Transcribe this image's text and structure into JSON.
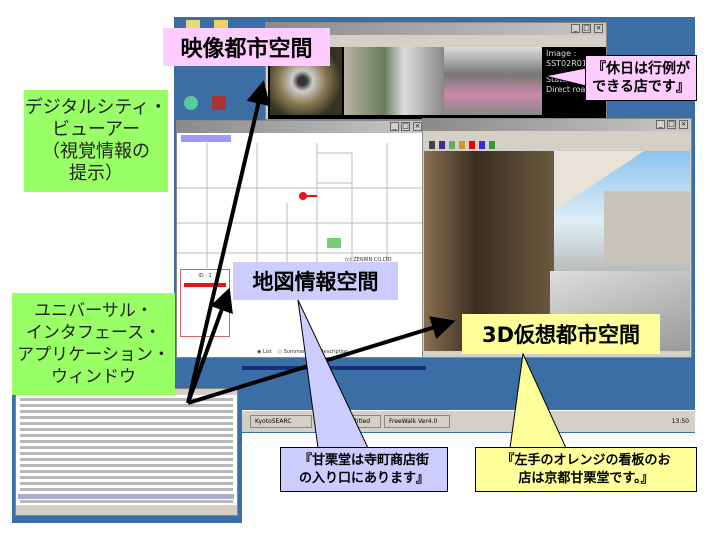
{
  "labels": {
    "video_space": "映像都市空間",
    "map_space": "地図情報空間",
    "virtual_3d_space": "3D仮想都市空間",
    "viewer": [
      "デジタルシティ・",
      "ビューアー",
      "（視覚情報の",
      "提示）"
    ],
    "uia_window": [
      "ユニバーサル・",
      "インタフェース・",
      "アプリケーション・",
      "ウィンドウ"
    ]
  },
  "callouts": {
    "video": [
      "『休日は行例が",
      "できる店です』"
    ],
    "map": [
      "『甘栗堂は寺町商店街",
      "の入り口にあります』"
    ],
    "virtual": [
      "『左手のオレンジの看板のお",
      "店は京都甘栗堂です。』"
    ]
  },
  "video_window": {
    "image_label": "Image :",
    "image_id": "SST02R01 0",
    "status_label": "Status :",
    "status_value": "Direct road"
  },
  "map_window": {
    "id_label": "ID : 1",
    "radio_options": [
      "List",
      "Summary",
      "Description"
    ],
    "copyright": "(c) ZENRIN CO.LTD"
  },
  "taskbar": {
    "items": [
      "KyotoSEARC",
      "Viewer - Untitled",
      "FreeWalk Ver4.0"
    ],
    "clock": "13:50"
  },
  "colors": {
    "desktop": "#3a6ea5",
    "pink": "#ffccff",
    "blue": "#ccccff",
    "yellow": "#ffff99",
    "green": "#99ff66"
  }
}
